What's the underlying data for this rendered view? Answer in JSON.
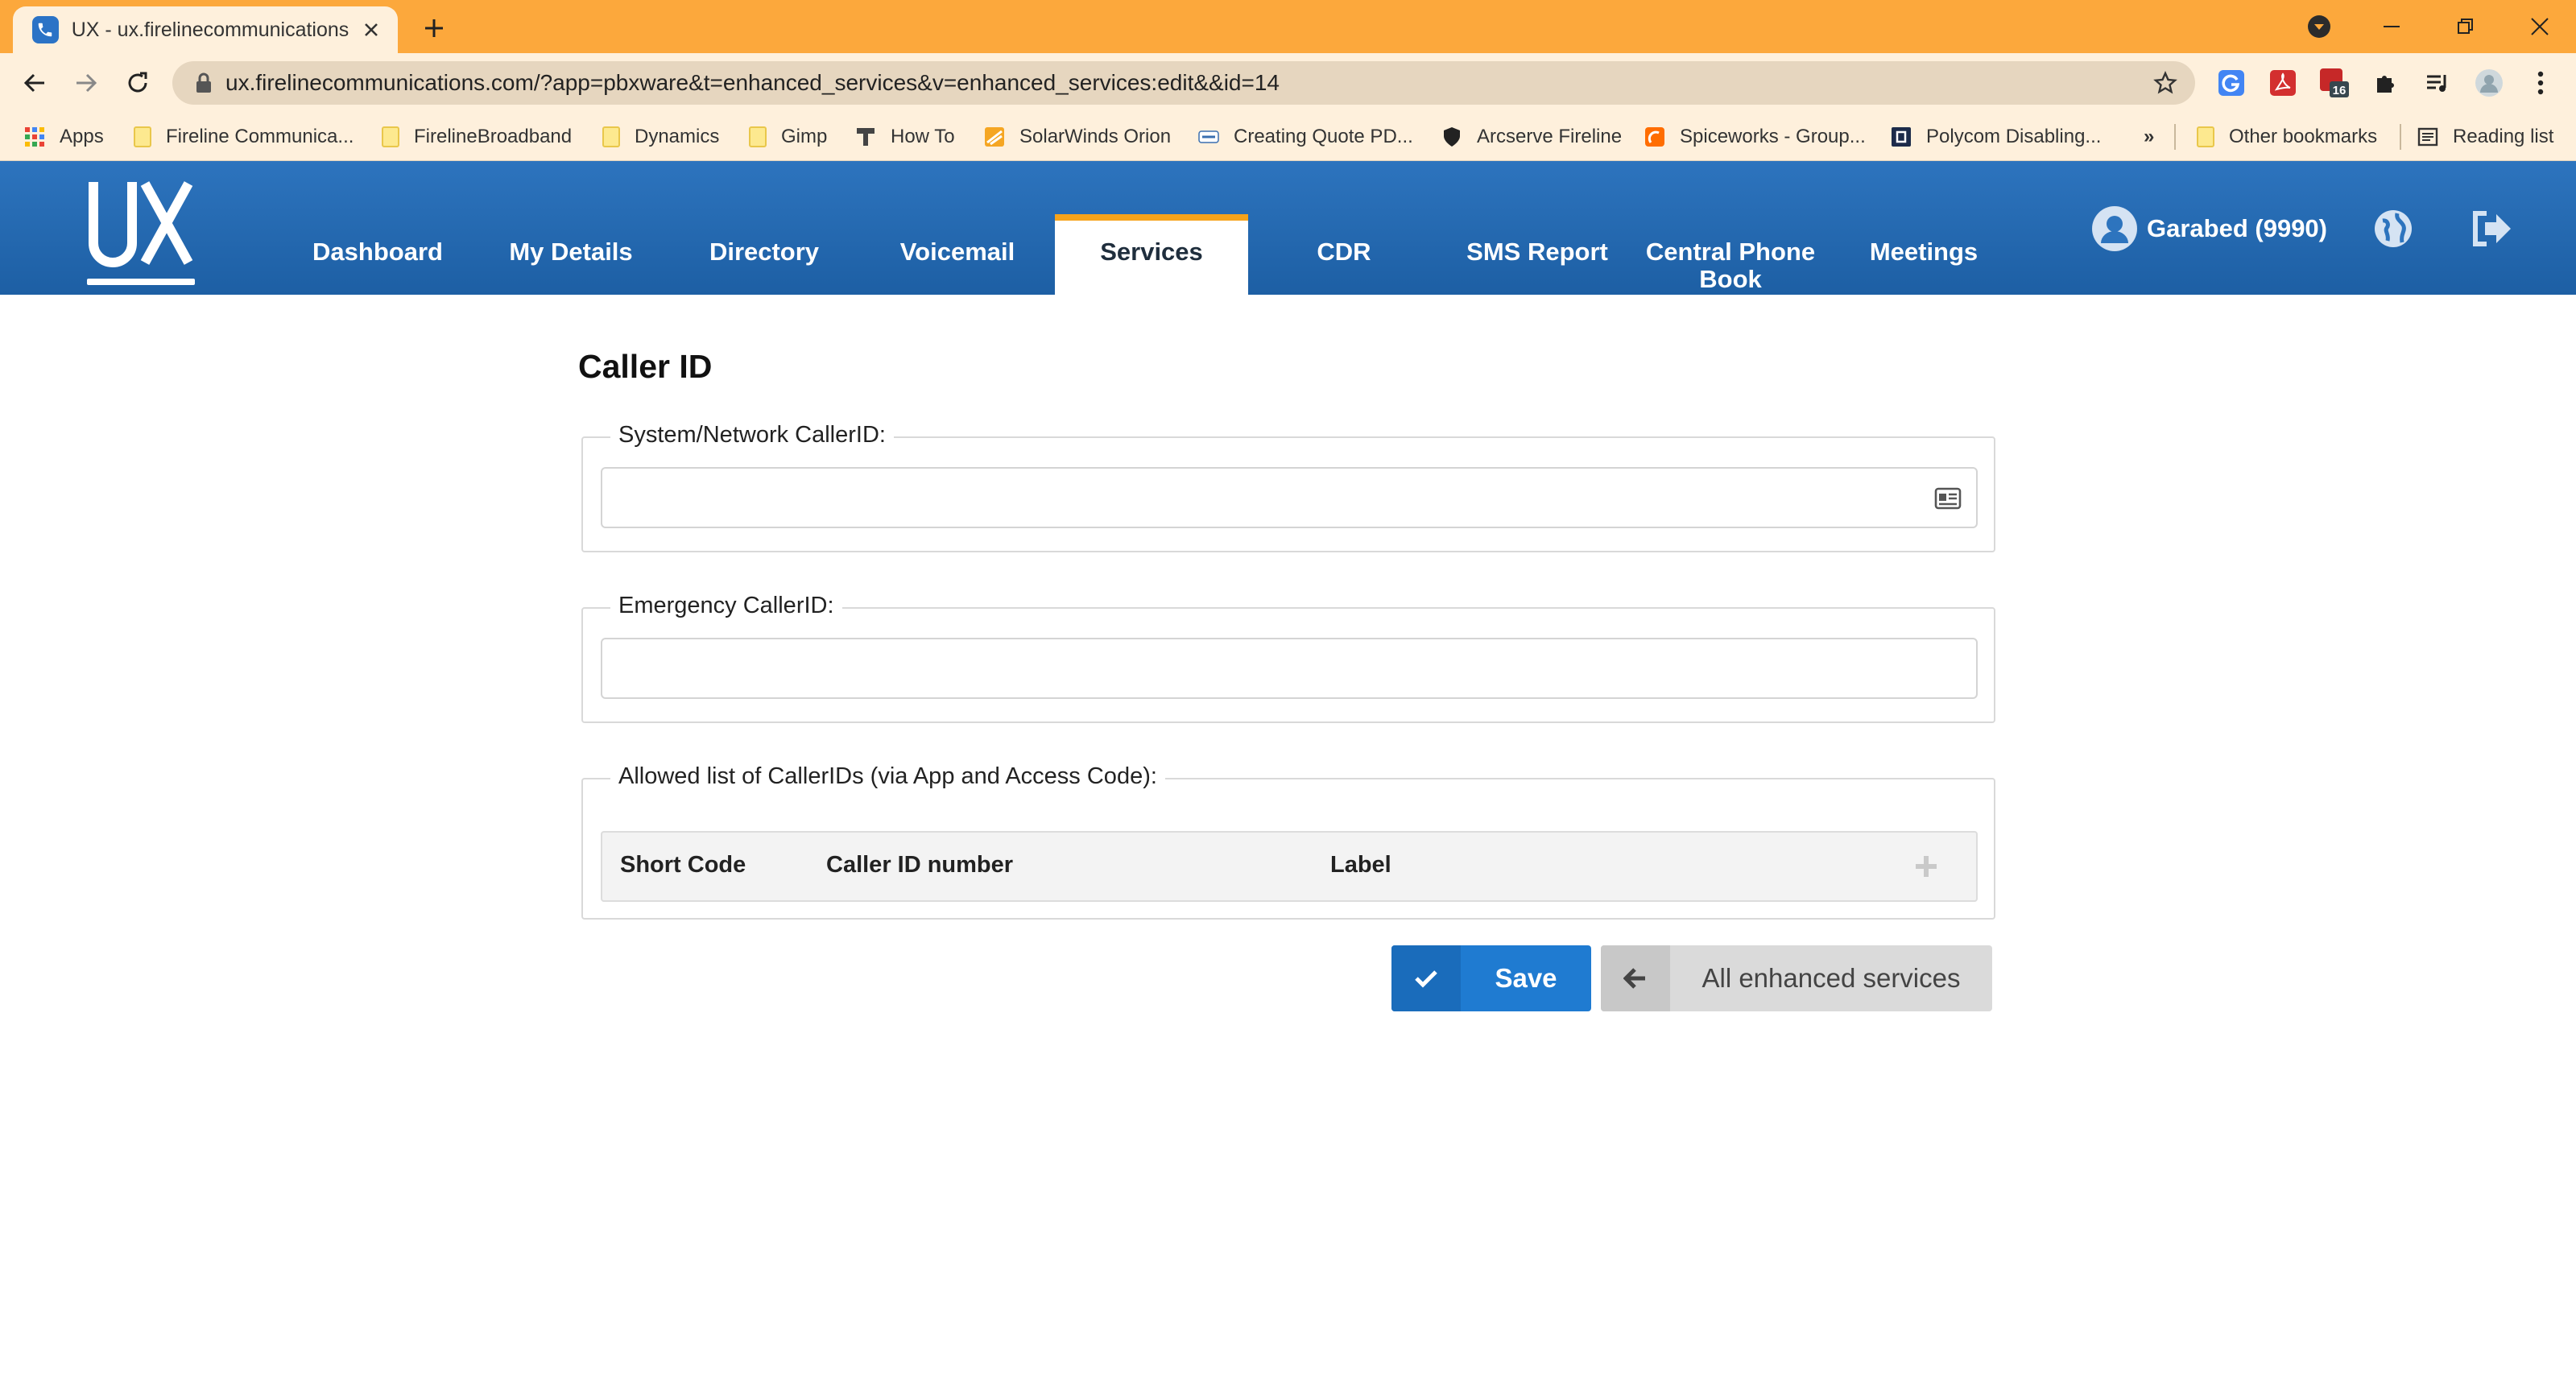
{
  "browser": {
    "tab_title": "UX - ux.firelinecommunications.c",
    "url": "ux.firelinecommunications.com/?app=pbxware&t=enhanced_services&v=enhanced_services:edit&&id=14",
    "extension_badge": "16",
    "bookmarks": [
      "Apps",
      "Fireline Communica...",
      "FirelineBroadband",
      "Dynamics",
      "Gimp",
      "How To",
      "SolarWinds Orion",
      "Creating Quote PD...",
      "Arcserve Fireline",
      "Spiceworks - Group...",
      "Polycom Disabling..."
    ],
    "overflow_label": "»",
    "other_bookmarks": "Other bookmarks",
    "reading_list": "Reading list"
  },
  "app": {
    "logo_text": "UX",
    "nav": [
      "Dashboard",
      "My Details",
      "Directory",
      "Voicemail",
      "Services",
      "CDR",
      "SMS Report",
      "Central Phone Book",
      "Meetings"
    ],
    "active_nav": "Services",
    "user_label": "Garabed (9990)"
  },
  "form": {
    "title": "Caller ID",
    "system_callerid_label": "System/Network CallerID:",
    "system_callerid_value": "",
    "emergency_callerid_label": "Emergency CallerID:",
    "emergency_callerid_value": "",
    "allowed_list_label": "Allowed list of CallerIDs (via App and Access Code):",
    "columns": [
      "Short Code",
      "Caller ID number",
      "Label"
    ],
    "save_label": "Save",
    "back_label": "All enhanced services"
  },
  "colors": {
    "tabstrip": "#fca83c",
    "appbar": "#2d74be",
    "active_indicator": "#f5a31b",
    "save_button": "#1f7bd1",
    "back_button": "#dadada"
  }
}
